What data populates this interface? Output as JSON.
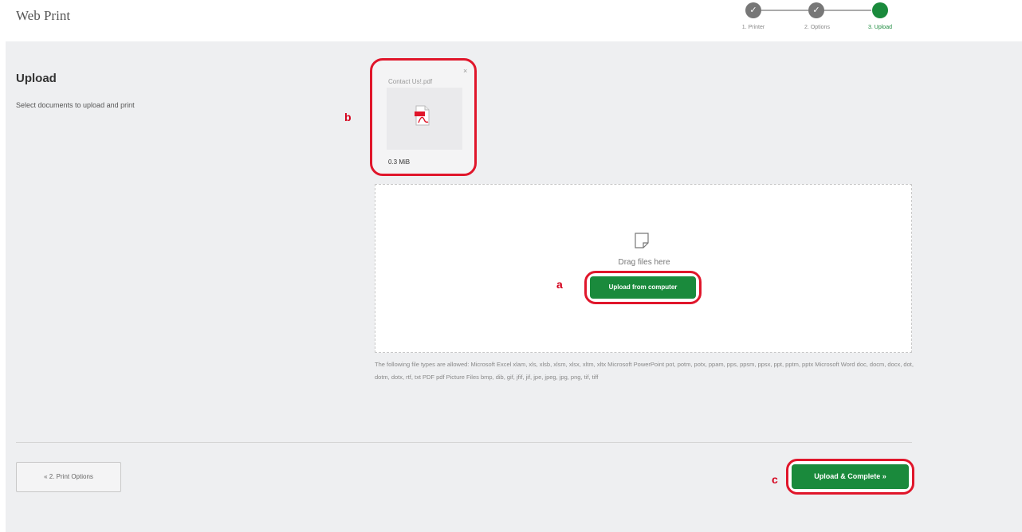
{
  "app": {
    "title": "Web Print"
  },
  "stepper": {
    "steps": [
      {
        "label": "1. Printer",
        "state": "done",
        "icon": "check-icon"
      },
      {
        "label": "2. Options",
        "state": "done",
        "icon": "check-icon"
      },
      {
        "label": "3. Upload",
        "state": "current"
      }
    ],
    "colors": {
      "done": "#777777",
      "current": "#1a8a3c"
    }
  },
  "upload_section": {
    "title": "Upload",
    "description": "Select documents to upload and print"
  },
  "file_card": {
    "name": "Contact Us!.pdf",
    "size": "0.3 MiB",
    "close_glyph": "×",
    "icon": "pdf-file-icon",
    "marker": "b"
  },
  "dropzone": {
    "icon": "document-icon",
    "drag_text": "Drag files here",
    "upload_button": "Upload from computer",
    "marker": "a"
  },
  "allowed_types_text": "The following file types are allowed: Microsoft Excel xlam, xls, xlsb, xlsm, xlsx, xltm, xltx Microsoft PowerPoint pot, potm, potx, ppam, pps, ppsm, ppsx, ppt, pptm, pptx Microsoft Word doc, docm, docx, dot, dotm, dotx, rtf, txt PDF pdf Picture Files bmp, dib, gif, jfif, jif, jpe, jpeg, jpg, png, tif, tiff",
  "footer": {
    "back_button": "« 2. Print Options",
    "complete_button": "Upload & Complete »",
    "marker": "c"
  },
  "colors": {
    "accent_green": "#1a8a3c",
    "highlight_red": "#e0162b",
    "background": "#eeeff1"
  }
}
